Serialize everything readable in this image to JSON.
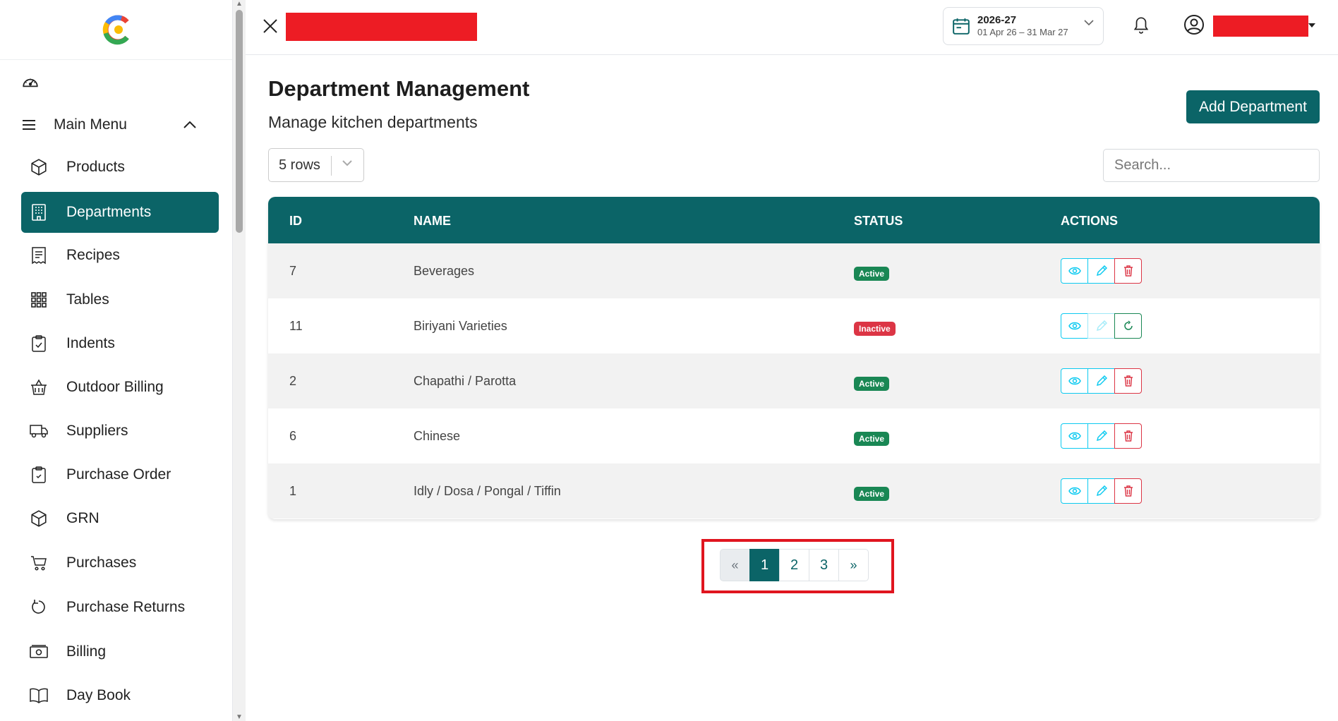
{
  "sidebar": {
    "menu_label": "Main Menu",
    "items": [
      {
        "label": "Products",
        "icon": "box-icon"
      },
      {
        "label": "Departments",
        "icon": "building-icon",
        "active": true
      },
      {
        "label": "Recipes",
        "icon": "receipt-icon"
      },
      {
        "label": "Tables",
        "icon": "grid-icon"
      },
      {
        "label": "Indents",
        "icon": "clipboard-check-icon"
      },
      {
        "label": "Outdoor Billing",
        "icon": "basket-icon"
      },
      {
        "label": "Suppliers",
        "icon": "truck-icon"
      },
      {
        "label": "Purchase Order",
        "icon": "clipboard-icon"
      },
      {
        "label": "GRN",
        "icon": "box-icon"
      },
      {
        "label": "Purchases",
        "icon": "cart-icon"
      },
      {
        "label": "Purchase Returns",
        "icon": "return-icon"
      },
      {
        "label": "Billing",
        "icon": "cash-icon"
      },
      {
        "label": "Day Book",
        "icon": "book-icon"
      }
    ]
  },
  "topbar": {
    "fy_year": "2026-27",
    "fy_range": "01 Apr 26 – 31 Mar 27"
  },
  "page": {
    "title": "Department Management",
    "subtitle": "Manage kitchen departments",
    "add_button": "Add Department",
    "rows_label": "5 rows",
    "search_placeholder": "Search..."
  },
  "table": {
    "headers": [
      "ID",
      "NAME",
      "STATUS",
      "ACTIONS"
    ],
    "rows": [
      {
        "id": "7",
        "name": "Beverages",
        "status": "Active"
      },
      {
        "id": "11",
        "name": "Biriyani Varieties",
        "status": "Inactive"
      },
      {
        "id": "2",
        "name": "Chapathi / Parotta",
        "status": "Active"
      },
      {
        "id": "6",
        "name": "Chinese",
        "status": "Active"
      },
      {
        "id": "1",
        "name": "Idly / Dosa / Pongal / Tiffin",
        "status": "Active"
      }
    ]
  },
  "pagination": {
    "prev": "«",
    "pages": [
      "1",
      "2",
      "3"
    ],
    "next": "»",
    "current": "1"
  },
  "colors": {
    "primary": "#0b6467",
    "active_badge": "#198754",
    "inactive_badge": "#dc3545",
    "redaction": "#ed1c24",
    "highlight": "#e0151f"
  }
}
